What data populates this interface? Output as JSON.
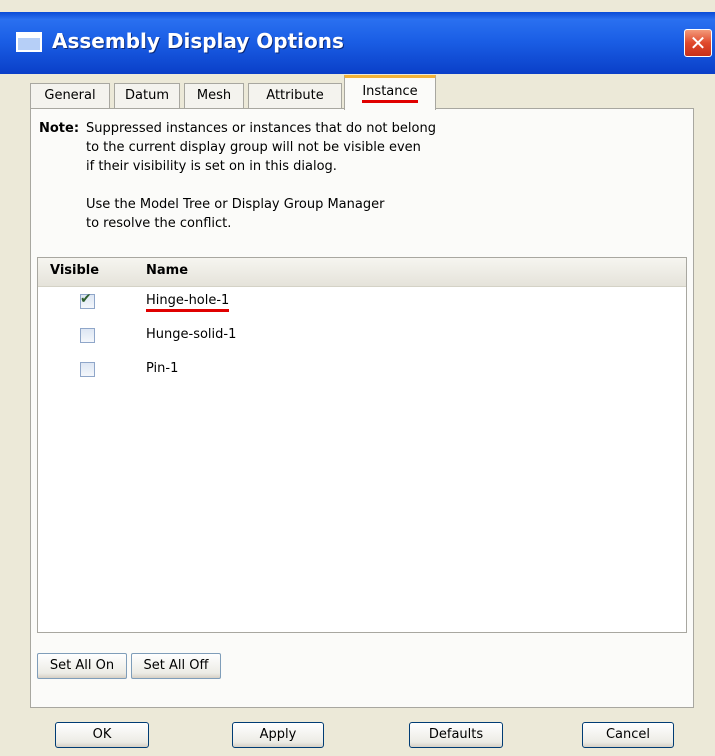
{
  "window": {
    "title": "Assembly Display Options",
    "close_icon": "close-icon"
  },
  "tabs": [
    {
      "label": "General"
    },
    {
      "label": "Datum"
    },
    {
      "label": "Mesh"
    },
    {
      "label": "Attribute"
    },
    {
      "label": "Instance",
      "active": true
    }
  ],
  "note": {
    "label": "Note:",
    "lines": [
      "Suppressed instances or instances that do not belong",
      "to the current display group will not be visible even",
      "if their visibility is set on in this dialog.",
      "",
      "Use the Model Tree or Display Group Manager",
      "to resolve the conflict."
    ]
  },
  "table": {
    "columns": {
      "visible": "Visible",
      "name": "Name"
    },
    "rows": [
      {
        "visible": true,
        "name": "Hinge-hole-1"
      },
      {
        "visible": false,
        "name": "Hunge-solid-1"
      },
      {
        "visible": false,
        "name": "Pin-1"
      }
    ]
  },
  "panel_buttons": {
    "set_all_on": "Set All On",
    "set_all_off": "Set All Off"
  },
  "dialog_buttons": {
    "ok": "OK",
    "apply": "Apply",
    "defaults": "Defaults",
    "cancel": "Cancel"
  },
  "colors": {
    "title_bar": "#1b5fe6",
    "highlight_underline": "#e00000",
    "active_tab_accent": "#f2b238"
  }
}
